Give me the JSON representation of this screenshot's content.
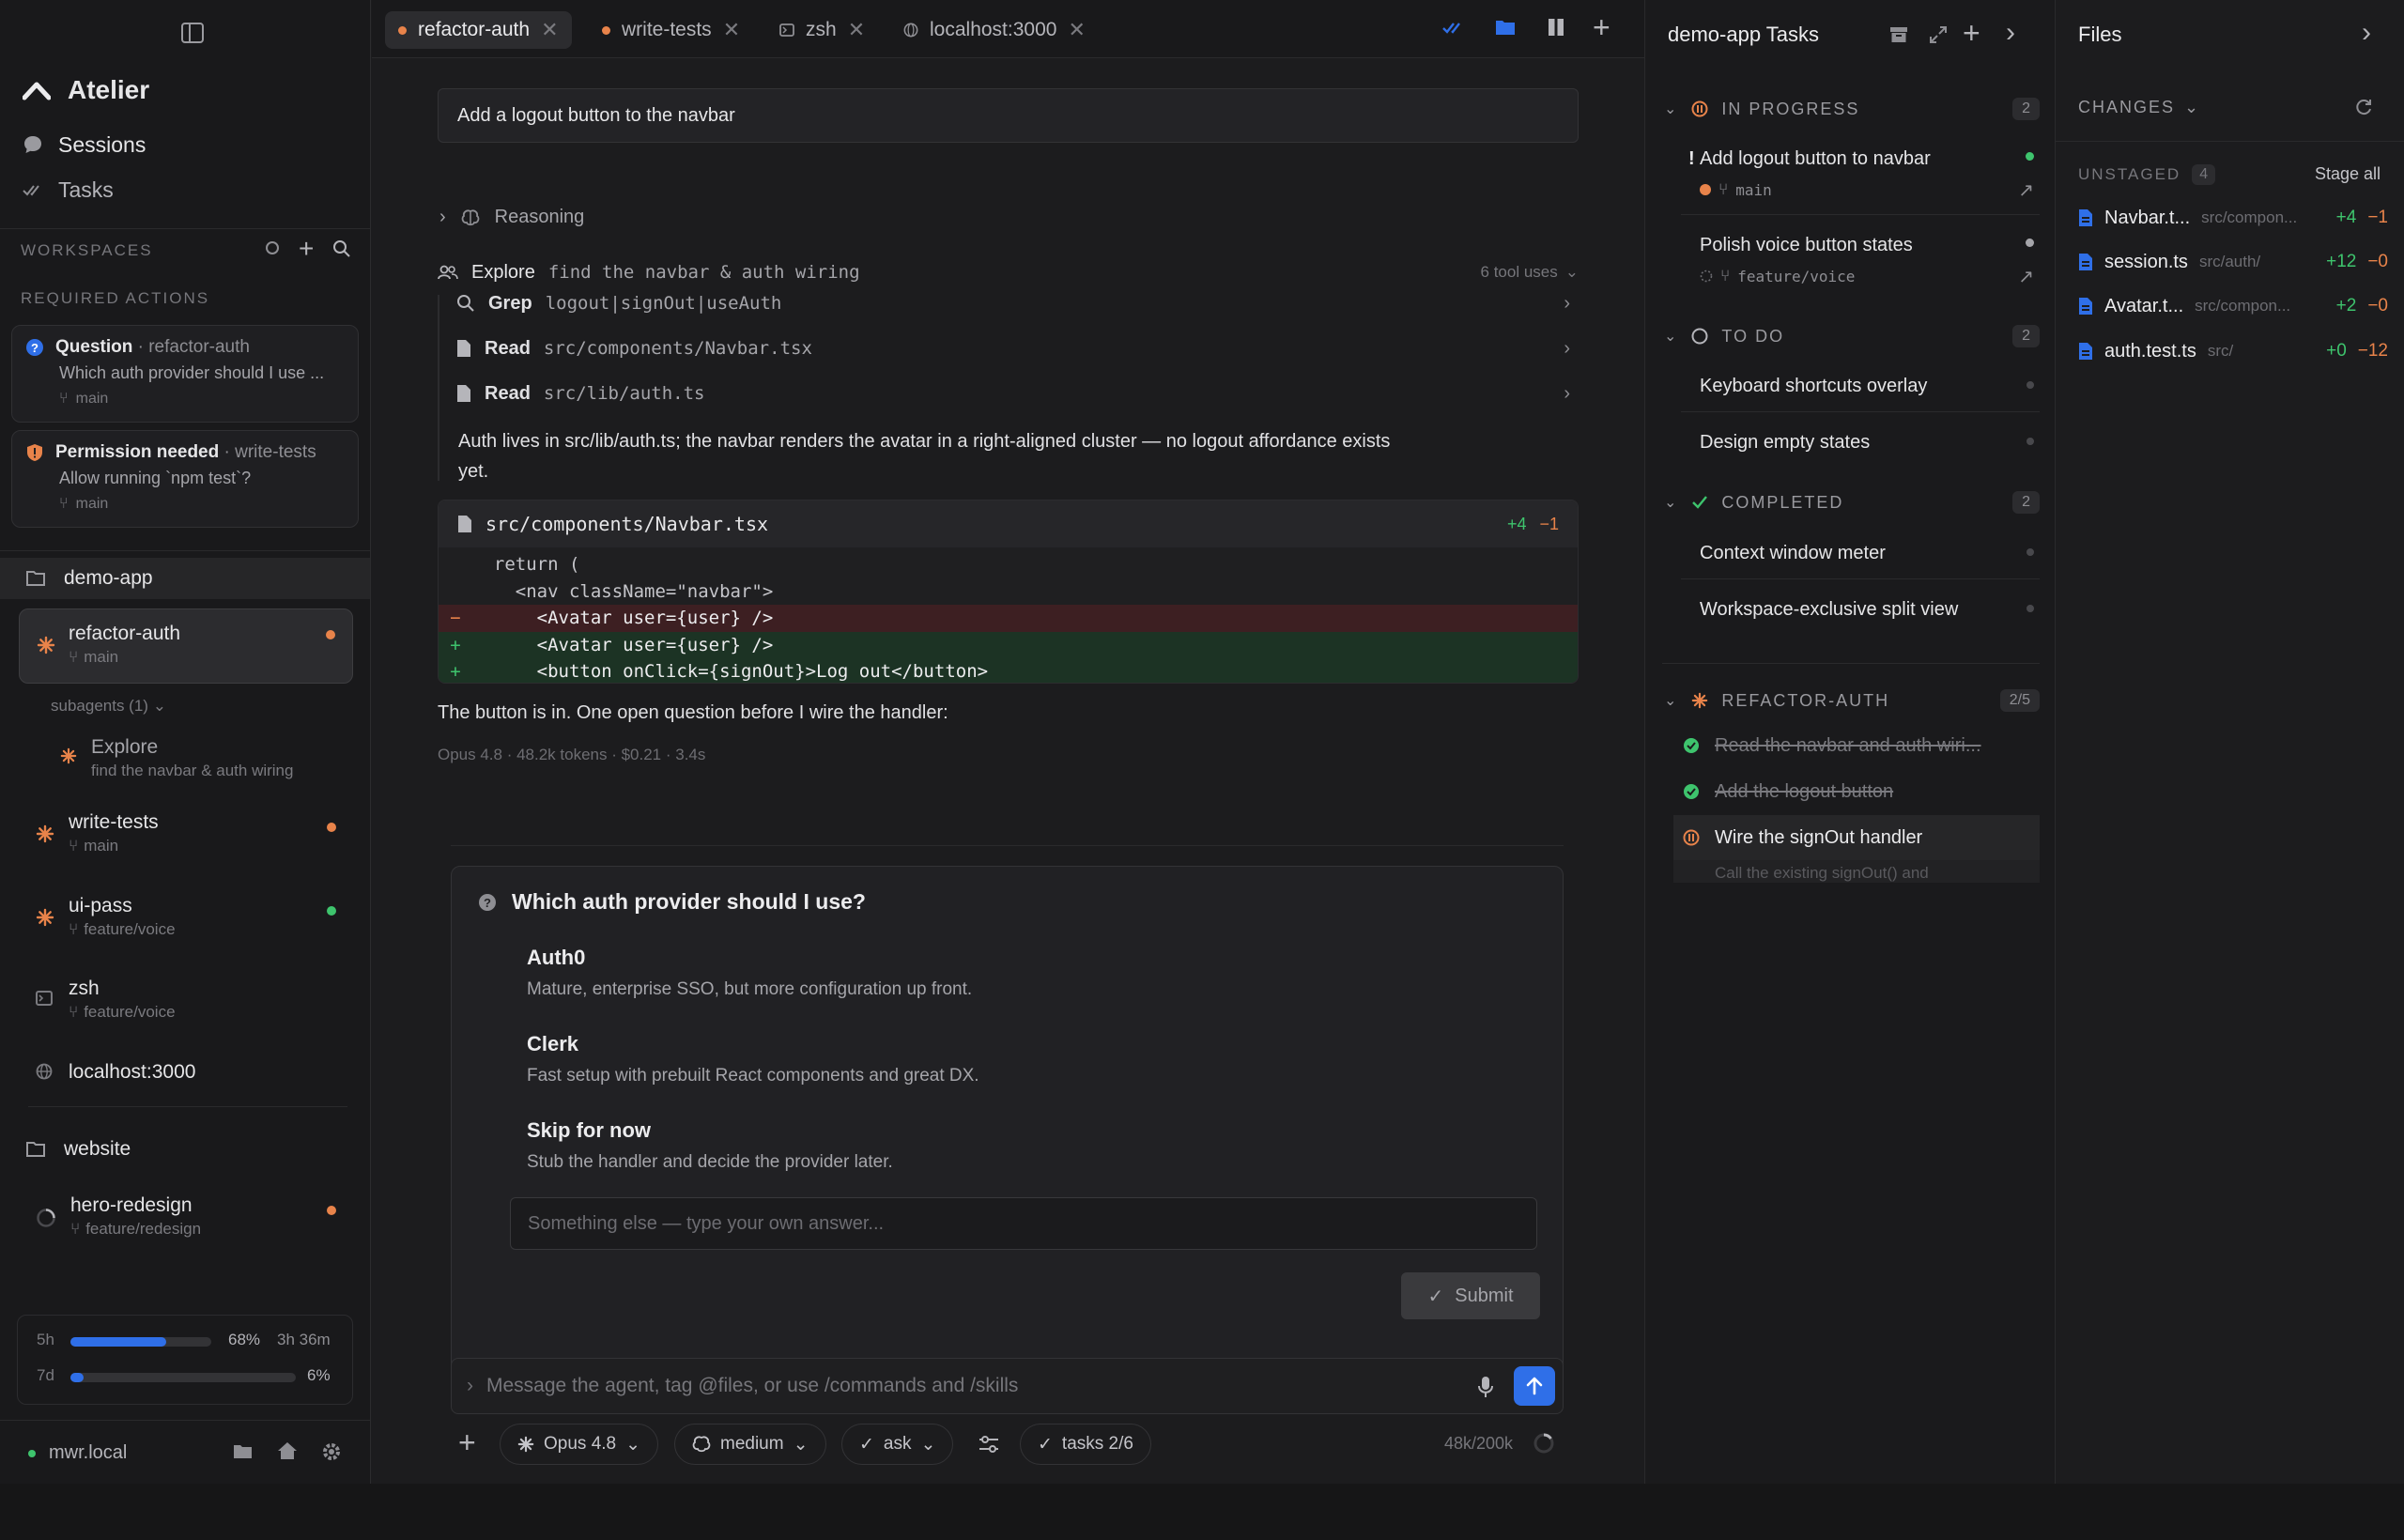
{
  "tabs": [
    {
      "label": "refactor-auth",
      "active": true,
      "icon": "dot-orange"
    },
    {
      "label": "write-tests",
      "active": false,
      "icon": "dot-orange"
    },
    {
      "label": "zsh",
      "active": false,
      "icon": "terminal-icon"
    },
    {
      "label": "localhost:3000",
      "active": false,
      "icon": "globe-icon"
    }
  ],
  "sidebar": {
    "app_name": "Atelier",
    "nav": [
      {
        "label": "Sessions"
      },
      {
        "label": "Tasks"
      }
    ],
    "workspaces_header": "WORKSPACES",
    "required_header": "REQUIRED ACTIONS",
    "cards": [
      {
        "kind": "Question",
        "session": "· refactor-auth",
        "text": "Which auth provider should I use ...",
        "branch": "main"
      },
      {
        "kind": "Permission needed",
        "session": "· write-tests",
        "text": "Allow running `npm test`?",
        "branch": "main"
      }
    ],
    "workspaces": [
      {
        "name": "demo-app"
      },
      {
        "name": "website"
      }
    ],
    "sessions": [
      {
        "name": "refactor-auth",
        "branch": "main"
      },
      {
        "subagents_label": "subagents (1)"
      },
      {
        "name": "Explore",
        "branch": "find the navbar & auth wiring"
      },
      {
        "name": "write-tests",
        "branch": "main"
      },
      {
        "name": "ui-pass",
        "branch": "feature/voice"
      },
      {
        "name": "zsh",
        "branch": "feature/voice"
      },
      {
        "name": "localhost:3000"
      },
      {
        "name": "hero-redesign",
        "branch": "feature/redesign"
      }
    ],
    "usage": [
      {
        "label": "5h",
        "percent_text": "68%",
        "percent": 68,
        "reset": "3h 36m"
      },
      {
        "label": "7d",
        "percent_text": "6%",
        "percent": 6
      }
    ],
    "host": "mwr.local"
  },
  "main": {
    "prompt": "Add a logout button to the navbar",
    "reasoning_label": "Reasoning",
    "explore_label": "Explore",
    "explore_desc": "find the navbar & auth wiring",
    "tool_uses": "6 tool uses",
    "tools": [
      {
        "name": "Grep",
        "arg": "logout|signOut|useAuth"
      },
      {
        "name": "Read",
        "arg": "src/components/Navbar.tsx"
      },
      {
        "name": "Read",
        "arg": "src/lib/auth.ts"
      }
    ],
    "summary_line1": "Auth lives in src/lib/auth.ts; the navbar renders the avatar in a right-aligned cluster — no logout affordance exists",
    "summary_line2": "yet.",
    "diff": {
      "file": "src/components/Navbar.tsx",
      "added": "+4",
      "removed": "−1",
      "lines": [
        {
          "g": "",
          "text": "  return (",
          "type": "ctx"
        },
        {
          "g": "",
          "text": "    <nav className=\"navbar\">",
          "type": "ctx"
        },
        {
          "g": "−",
          "text": "      <Avatar user={user} />",
          "type": "del"
        },
        {
          "g": "+",
          "text": "      <Avatar user={user} />",
          "type": "add"
        },
        {
          "g": "+",
          "text": "      <button onClick={signOut}>Log out</button>",
          "type": "add"
        }
      ]
    },
    "after_diff": "The button is in. One open question before I wire the handler:",
    "meta": "Opus 4.8 · 48.2k tokens · $0.21 · 3.4s",
    "question": {
      "title": "Which auth provider should I use?",
      "options": [
        {
          "title": "Auth0",
          "desc": "Mature, enterprise SSO, but more configuration up front."
        },
        {
          "title": "Clerk",
          "desc": "Fast setup with prebuilt React components and great DX."
        },
        {
          "title": "Skip for now",
          "desc": "Stub the handler and decide the provider later."
        }
      ],
      "placeholder": "Something else — type your own answer...",
      "submit": "Submit"
    },
    "composer_placeholder": "Message the agent, tag @files, or use /commands and /skills",
    "toolbar": {
      "model": "Opus 4.8",
      "effort": "medium",
      "mode": "ask",
      "tasks": "tasks 2/6",
      "context": "48k/200k"
    }
  },
  "tasks_panel": {
    "title": "demo-app Tasks",
    "groups": [
      {
        "label": "IN PROGRESS",
        "count": "2"
      },
      {
        "label": "TO DO",
        "count": "2"
      },
      {
        "label": "COMPLETED",
        "count": "2"
      },
      {
        "label": "REFACTOR-AUTH",
        "count": "2/5"
      }
    ],
    "in_progress": [
      {
        "title": "Add logout button to navbar",
        "branch": "main",
        "prefix": "!"
      },
      {
        "title": "Polish voice button states",
        "branch": "feature/voice"
      }
    ],
    "todo": [
      {
        "title": "Keyboard shortcuts overlay"
      },
      {
        "title": "Design empty states"
      }
    ],
    "completed": [
      {
        "title": "Context window meter"
      },
      {
        "title": "Workspace-exclusive split view"
      }
    ],
    "refactor": [
      {
        "title": "Read the navbar and auth wiri...",
        "done": true
      },
      {
        "title": "Add the logout button",
        "done": true
      },
      {
        "title": "Wire the signOut handler",
        "done": false
      },
      {
        "title": "Call the existing signOut() and",
        "done": false
      }
    ]
  },
  "files_panel": {
    "title": "Files",
    "changes_label": "CHANGES",
    "unstaged_label": "UNSTAGED",
    "unstaged_count": "4",
    "stage_all": "Stage all",
    "files": [
      {
        "name": "Navbar.t...",
        "path": "src/compon...",
        "add": "+4",
        "del": "−1"
      },
      {
        "name": "session.ts",
        "path": "src/auth/",
        "add": "+12",
        "del": "−0"
      },
      {
        "name": "Avatar.t...",
        "path": "src/compon...",
        "add": "+2",
        "del": "−0"
      },
      {
        "name": "auth.test.ts",
        "path": "src/",
        "add": "+0",
        "del": "−12"
      }
    ]
  },
  "colors": {
    "accent": "#2f6fe8",
    "orange": "#e8834a",
    "green": "#3ec46d"
  }
}
